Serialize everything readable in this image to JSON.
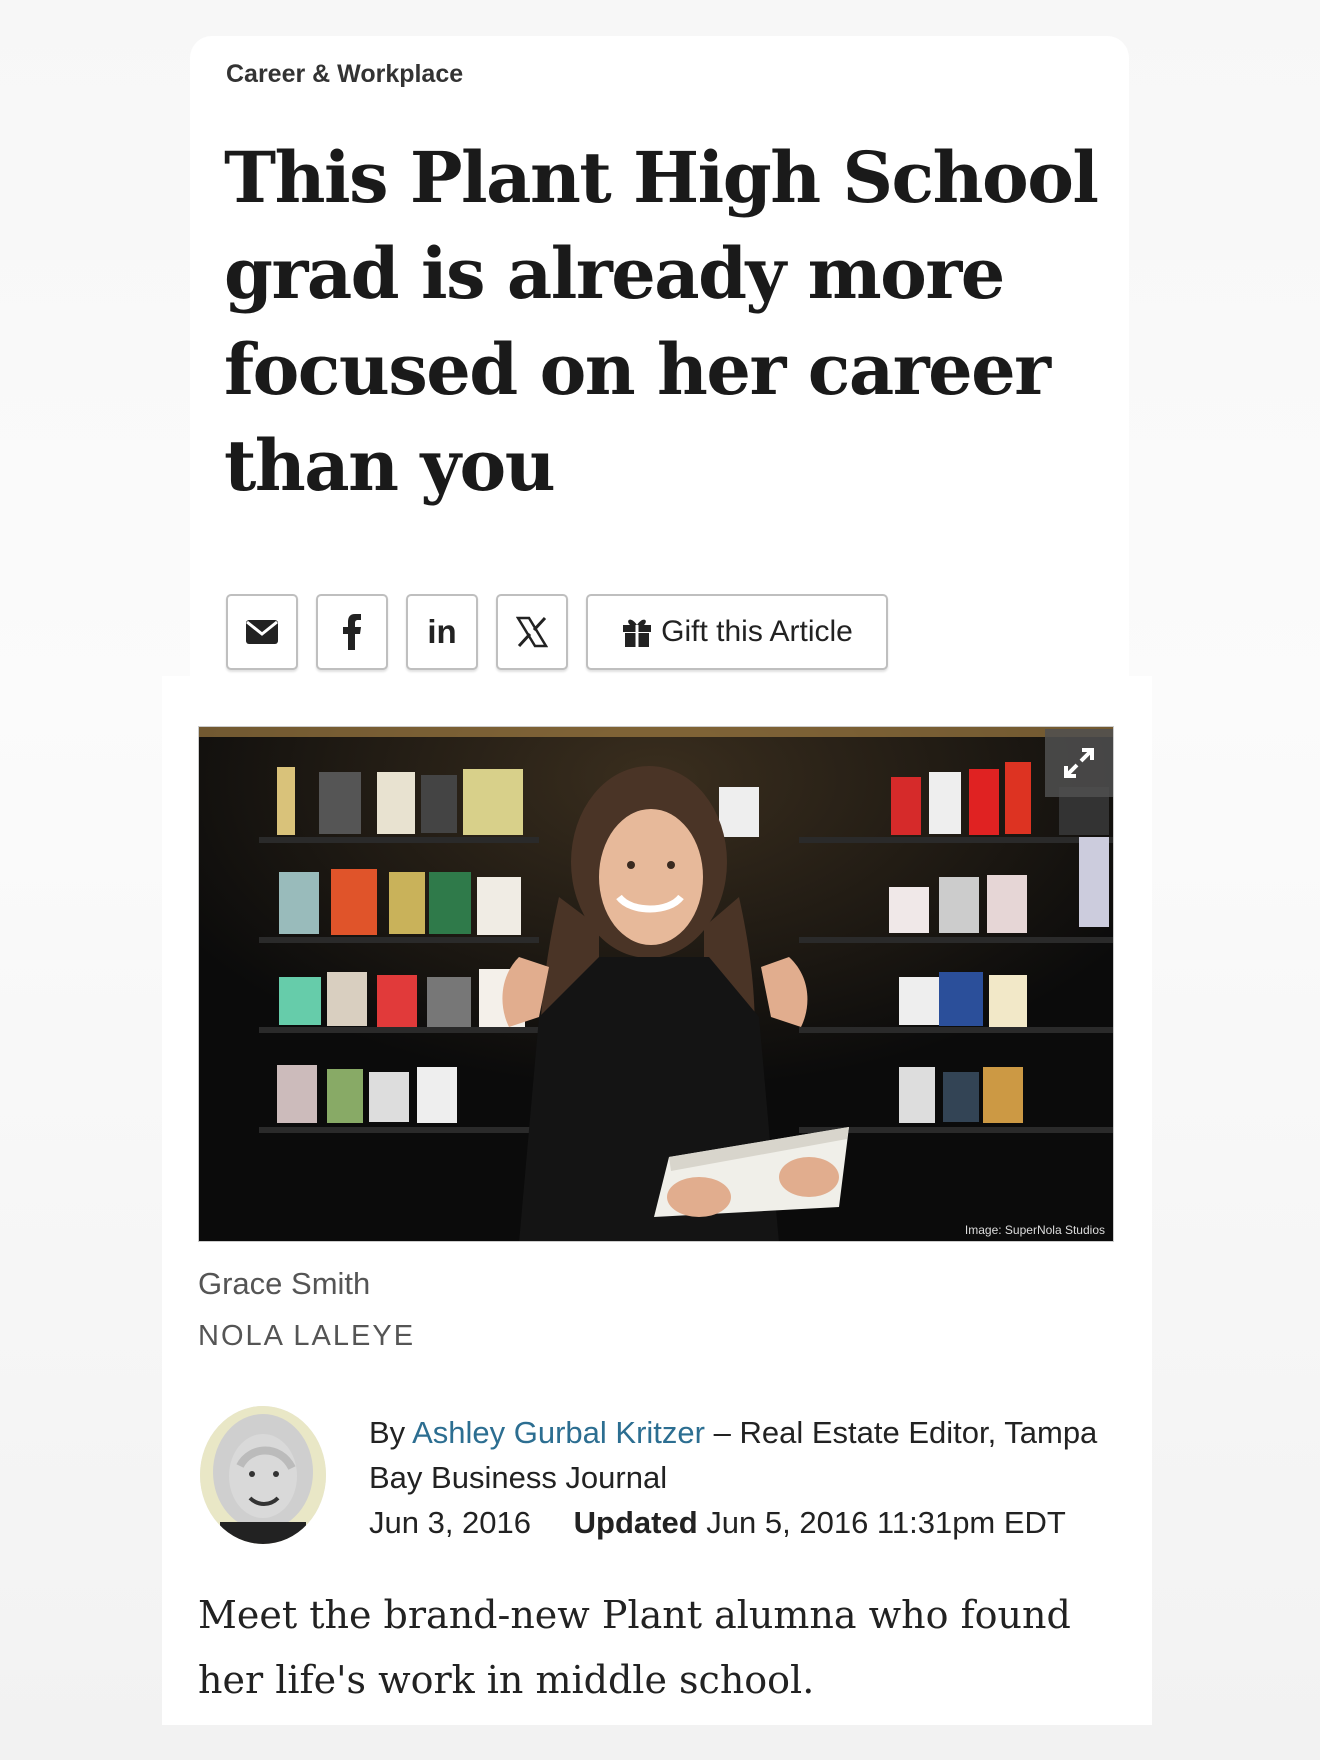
{
  "section": "Career & Workplace",
  "headline": "This Plant High School grad is already more focused on her career than you",
  "share": {
    "email_icon": "envelope-icon",
    "facebook_icon": "facebook-icon",
    "linkedin_label": "in",
    "x_icon": "x-icon",
    "gift_label": "Gift this Article"
  },
  "hero_image": {
    "credit": "Image: SuperNola Studios",
    "expand_icon": "expand-icon"
  },
  "caption": "Grace Smith",
  "photo_credit": "NOLA LALEYE",
  "byline": {
    "prefix": "By",
    "author": "Ashley Gurbal Kritzer",
    "role": " – Real Estate Editor, Tampa Bay Business Journal",
    "published": "Jun 3, 2016",
    "updated_label": "Updated",
    "updated": "Jun 5, 2016 11:31pm EDT"
  },
  "dek": "Meet the brand-new Plant alumna who found her life's work in middle school.",
  "colors": {
    "link": "#2c6e91",
    "text": "#222222",
    "border": "#bfbfbf"
  }
}
